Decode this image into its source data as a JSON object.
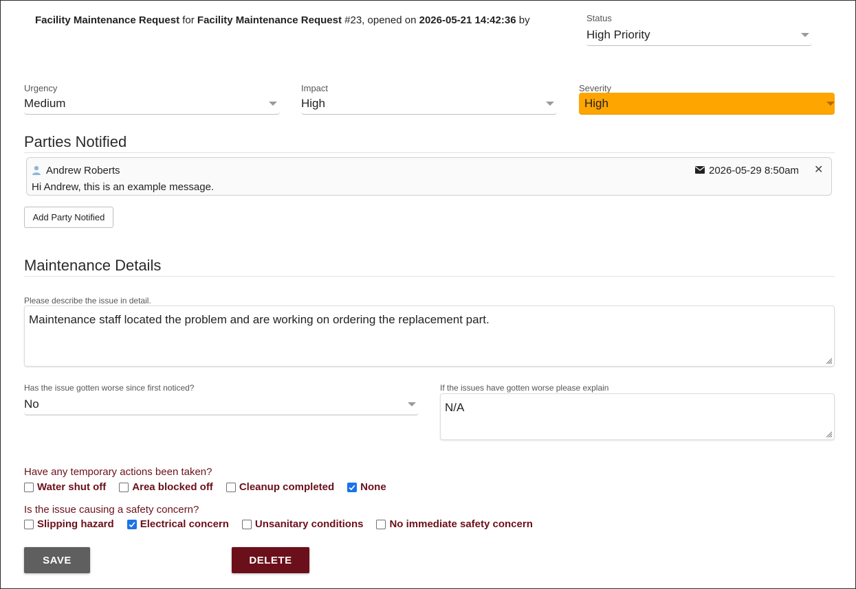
{
  "header": {
    "form_name": "Facility Maintenance Request",
    "for_word": "for",
    "request_name": "Facility Maintenance Request",
    "request_number": "#23, opened on",
    "opened_at": "2026-05-21 14:42:36",
    "by_word": "by"
  },
  "status": {
    "label": "Status",
    "value": "High Priority"
  },
  "urgency": {
    "label": "Urgency",
    "value": "Medium"
  },
  "impact": {
    "label": "Impact",
    "value": "High"
  },
  "severity": {
    "label": "Severity",
    "value": "High",
    "color": "#ffa500"
  },
  "parties": {
    "title": "Parties Notified",
    "items": [
      {
        "name": "Andrew Roberts",
        "message": "Hi Andrew, this is an example message.",
        "sent_at": "2026-05-29 8:50am",
        "icon": "person-icon",
        "sent_icon": "envelope-icon"
      }
    ],
    "add_button": "Add Party Notified"
  },
  "details": {
    "title": "Maintenance Details",
    "describe_label": "Please describe the issue in detail.",
    "describe_value": "Maintenance staff located the problem and are working on ordering the replacement part.",
    "worse_label": "Has the issue gotten worse since first noticed?",
    "worse_value": "No",
    "explain_label": "If the issues have gotten worse please explain",
    "explain_value": "N/A"
  },
  "temporary_actions": {
    "question": "Have any temporary actions been taken?",
    "options": [
      {
        "label": "Water shut off",
        "checked": false
      },
      {
        "label": "Area blocked off",
        "checked": false
      },
      {
        "label": "Cleanup completed",
        "checked": false
      },
      {
        "label": "None",
        "checked": true
      }
    ]
  },
  "safety": {
    "question": "Is the issue causing a safety concern?",
    "options": [
      {
        "label": "Slipping hazard",
        "checked": false
      },
      {
        "label": "Electrical concern",
        "checked": true
      },
      {
        "label": "Unsanitary conditions",
        "checked": false
      },
      {
        "label": "No immediate safety concern",
        "checked": false
      }
    ]
  },
  "actions": {
    "save": "SAVE",
    "delete": "DELETE",
    "save_color": "#5f5f5f",
    "delete_color": "#6b0f1a"
  },
  "colors": {
    "accent_maroon": "#6b0f1a",
    "checkbox_blue": "#1a73e8"
  }
}
